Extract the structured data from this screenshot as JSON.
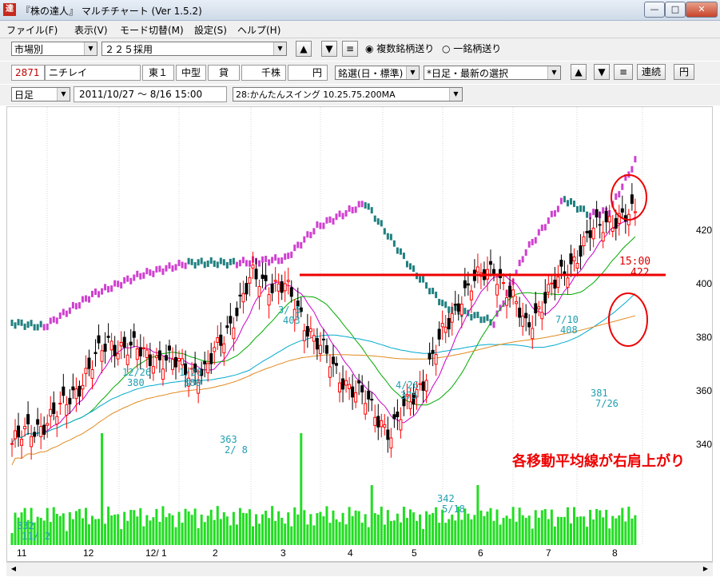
{
  "window": {
    "icon_text": "達",
    "title": "『株の達人』 マルチチャート (Ver 1.5.2)",
    "minimize": "—",
    "maximize": "□",
    "close": "✕"
  },
  "menu": [
    "ファイル(F)",
    "表示(V)",
    "モード切替(M)",
    "設定(S)",
    "ヘルプ(H)"
  ],
  "toolbar1": {
    "market_select": "市場別",
    "index_select": "２２５採用",
    "up": "▲",
    "down": "▼",
    "list": "≡",
    "radio_multi": "複数銘柄送り",
    "radio_single": "一銘柄送り"
  },
  "stock": {
    "code": "2871",
    "name": "ニチレイ",
    "market": "東１",
    "size": "中型",
    "margin": "貸",
    "unit": "千株",
    "yen": "円",
    "sort_select": "銘選(日・標準)",
    "preset_select": "*日足・最新の選択",
    "up": "▲",
    "down": "▼",
    "list": "≡",
    "continuous": "連続",
    "yen_btn": "円"
  },
  "toolbar3": {
    "period_select": "日足",
    "range_text": "2011/10/27 〜  8/16 15:00",
    "indicator_select": "28:かんたんスイング  10.25.75.200MA"
  },
  "colors": {
    "candle_up": "#ff0000",
    "candle_down": "#000000",
    "ma_short": "#cc00cc",
    "ma_mid": "#00aa00",
    "ma_long": "#00aacc",
    "ma_200": "#e08a20",
    "volume": "#22dd22",
    "resistance": "#ee0000",
    "upper_up": "#d040d0",
    "upper_down": "#208080"
  },
  "chart_data": {
    "type": "candlestick",
    "y_ticks": [
      340,
      360,
      380,
      400,
      420
    ],
    "x_ticks": [
      "11",
      "12",
      "12/ 1",
      "2",
      "3",
      "4",
      "5",
      "6",
      "7",
      "8"
    ],
    "annotations": [
      {
        "date": "11/ 2",
        "value": "332"
      },
      {
        "date": "12/26",
        "value": "380"
      },
      {
        "date": "1/20",
        "value": "380"
      },
      {
        "date": "2/ 8",
        "value": "363"
      },
      {
        "date": "3/ 5",
        "value": "403"
      },
      {
        "date": "4/26",
        "value": "375"
      },
      {
        "date": "5/18",
        "value": "342"
      },
      {
        "date": "7/10",
        "value": "408"
      },
      {
        "date": "7/26",
        "value": "381"
      }
    ],
    "last_time": "15:00",
    "last_price": "422",
    "resistance_level": 403,
    "note": "各移動平均線が右肩上がり",
    "ylim": [
      330,
      430
    ]
  }
}
